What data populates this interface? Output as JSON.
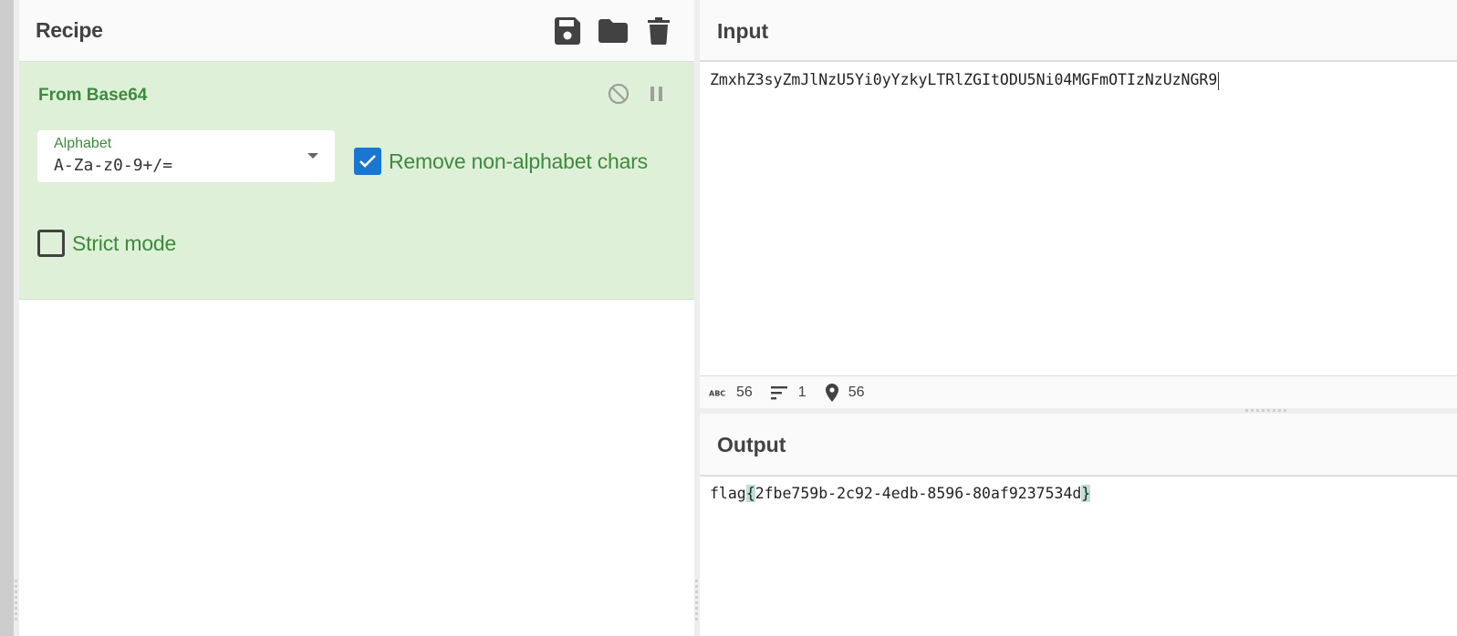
{
  "recipe": {
    "title": "Recipe",
    "icons": [
      "save-icon",
      "folder-open-icon",
      "trash-icon"
    ],
    "operations": [
      {
        "name": "From Base64",
        "controls": [
          "disable-icon",
          "pause-icon"
        ],
        "alphabet": {
          "label": "Alphabet",
          "value": "A-Za-z0-9+/="
        },
        "remove_non_alphabet": {
          "label": "Remove non-alphabet chars",
          "checked": true
        },
        "strict_mode": {
          "label": "Strict mode",
          "checked": false
        }
      }
    ]
  },
  "input": {
    "title": "Input",
    "value": "ZmxhZ3syZmJlNzU5Yi0yYzkyLTRlZGItODU5Ni04MGFmOTIzNzUzNGR9",
    "status": {
      "length": "56",
      "lines": "1",
      "position": "56"
    }
  },
  "output": {
    "title": "Output",
    "prefix": "flag",
    "open_brace": "{",
    "body": "2fbe759b-2c92-4edb-8596-80af9237534d",
    "close_brace": "}"
  },
  "colors": {
    "operation_bg": "#dff0d8",
    "operation_text": "#3c8b3c",
    "checkbox_on": "#1976d2",
    "bracket_highlight": "#bcdfd9"
  }
}
